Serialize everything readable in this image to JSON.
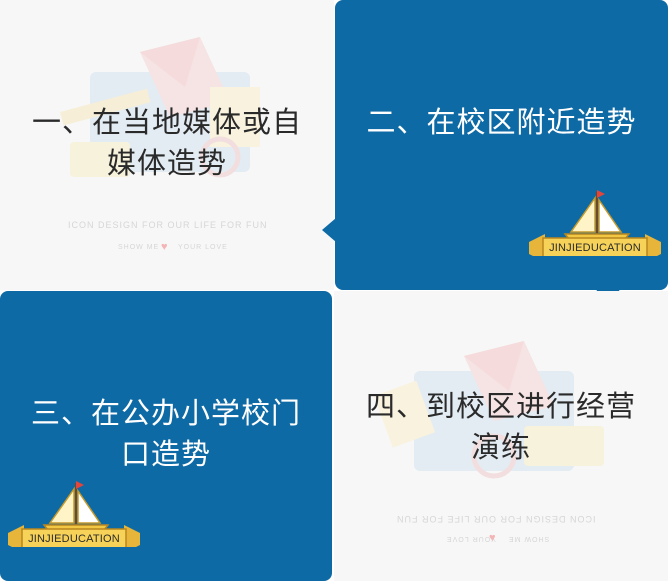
{
  "panels": [
    {
      "lines": [
        "一、在当地媒体或自",
        "媒体造势"
      ]
    },
    {
      "lines": [
        "二、在校区附近造势"
      ]
    },
    {
      "lines": [
        "三、在公办小学校门",
        "口造势"
      ]
    },
    {
      "lines": [
        "四、到校区进行经营",
        "演练"
      ]
    }
  ],
  "watermark": {
    "tagline": "ICON DESIGN FOR OUR LIFE FOR FUN",
    "show_me": "SHOW ME",
    "your_love": "YOUR LOVE"
  },
  "badge": {
    "label": "JINJIEDUCATION"
  },
  "colors": {
    "accent_blue": "#0e6aa5",
    "panel_bg": "#f7f7f7",
    "badge_gold": "#f2c744"
  }
}
